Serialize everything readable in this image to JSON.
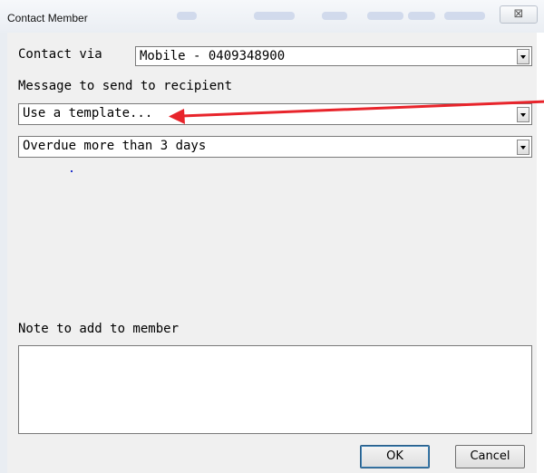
{
  "window": {
    "title": "Contact Member",
    "close_glyph": "⊠"
  },
  "form": {
    "contact_via_label": "Contact via",
    "contact_via_value": "Mobile - 0409348900",
    "message_label": "Message to send to recipient",
    "template_value": "Use a template...",
    "message_value": "Overdue more than 3 days",
    "note_label": "Note to add to member",
    "note_value": ""
  },
  "buttons": {
    "ok": "OK",
    "cancel": "Cancel"
  },
  "icons": {
    "close": "close-icon",
    "dropdown": "chevron-down-icon"
  },
  "colors": {
    "annotation_arrow": "#e8242b"
  }
}
